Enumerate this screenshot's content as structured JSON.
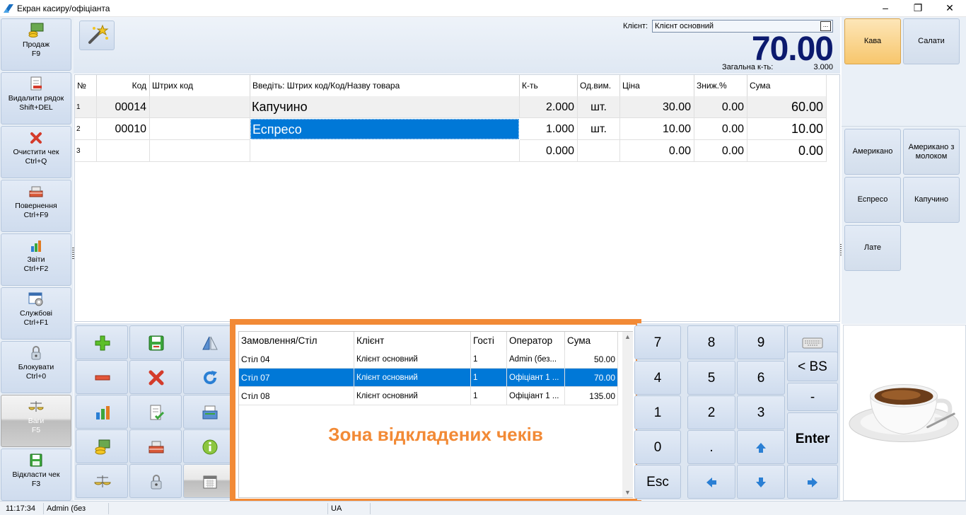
{
  "window": {
    "title": "Екран касиру/офіціанта",
    "icon": "app-logo-icon"
  },
  "header": {
    "client_label": "Клієнт:",
    "client_value": "Клієнт основний",
    "client_lookup_label": "...",
    "total": "70.00",
    "qty_label": "Загальна к-ть:",
    "qty_value": "3.000"
  },
  "sidebar": {
    "items": [
      {
        "label": "Продаж",
        "hotkey": "F9",
        "icon": "coins-cash-icon"
      },
      {
        "label": "Видалити рядок",
        "hotkey": "Shift+DEL",
        "icon": "delete-line-icon"
      },
      {
        "label": "Очистити чек",
        "hotkey": "Ctrl+Q",
        "icon": "red-x-icon"
      },
      {
        "label": "Повернення",
        "hotkey": "Ctrl+F9",
        "icon": "return-cart-icon"
      },
      {
        "label": "Звіти",
        "hotkey": "Ctrl+F2",
        "icon": "bar-chart-icon"
      },
      {
        "label": "Службові",
        "hotkey": "Ctrl+F1",
        "icon": "settings-window-icon"
      },
      {
        "label": "Блокувати",
        "hotkey": "Ctrl+0",
        "icon": "padlock-icon"
      },
      {
        "label": "Ваги",
        "hotkey": "F5",
        "icon": "scales-icon"
      },
      {
        "label": "Відкласти чек",
        "hotkey": "F3",
        "icon": "save-disk-icon"
      }
    ]
  },
  "table": {
    "columns": [
      "№",
      "Код",
      "Штрих код",
      "Введіть: Штрих код/Код/Назву товара",
      "К-ть",
      "Од.вим.",
      "Ціна",
      "Зниж.%",
      "Сума"
    ],
    "rows": [
      {
        "n": "1",
        "code": "00014",
        "barcode": "",
        "name": "Капучино",
        "qty": "2.000",
        "unit": "шт.",
        "price": "30.00",
        "disc": "0.00",
        "sum": "60.00"
      },
      {
        "n": "2",
        "code": "00010",
        "barcode": "",
        "name": "Еспресо",
        "qty": "1.000",
        "unit": "шт.",
        "price": "10.00",
        "disc": "0.00",
        "sum": "10.00"
      },
      {
        "n": "3",
        "code": "",
        "barcode": "",
        "name": "",
        "qty": "0.000",
        "unit": "",
        "price": "0.00",
        "disc": "0.00",
        "sum": "0.00"
      }
    ]
  },
  "toolbar": {
    "buttons": [
      "add-icon",
      "save-icon",
      "mirror-icon",
      "minus-icon",
      "delete-x-icon",
      "refresh-icon",
      "chart-icon",
      "checklist-icon",
      "cash-register-icon",
      "coins-icon",
      "return-cart-icon",
      "info-icon",
      "scales-icon",
      "padlock-icon",
      "calendar-icon"
    ]
  },
  "suspended": {
    "columns": [
      "Замовлення/Стіл",
      "Клієнт",
      "Гості",
      "Оператор",
      "Сума"
    ],
    "rows": [
      {
        "table": "Стіл 04",
        "client": "Клієнт основний",
        "guests": "1",
        "operator": "Admin (без...",
        "sum": "50.00"
      },
      {
        "table": "Стіл 07",
        "client": "Клієнт основний",
        "guests": "1",
        "operator": "Офіціант 1 ...",
        "sum": "70.00"
      },
      {
        "table": "Стіл 08",
        "client": "Клієнт основний",
        "guests": "1",
        "operator": "Офіціант 1 ...",
        "sum": "135.00"
      }
    ],
    "caption": "Зона відкладених чеків"
  },
  "numpad": {
    "keys": [
      "7",
      "8",
      "9",
      "keyboard",
      "4",
      "5",
      "6",
      "< BS",
      "1",
      "2",
      "3",
      "-",
      "0",
      ".",
      "up",
      "Enter",
      "Esc",
      "left",
      "down",
      "right"
    ]
  },
  "products": {
    "categories": [
      "Кава",
      "Салати"
    ],
    "items": [
      "Американо",
      "Американо з молоком",
      "Еспресо",
      "Капучино",
      "Лате"
    ]
  },
  "statusbar": {
    "time": "11:17:34",
    "user": "Admin (без",
    "lang": "UA"
  },
  "colors": {
    "accent_orange": "#f28a36",
    "selection_blue": "#0078d7",
    "total_navy": "#0c1a6e"
  }
}
